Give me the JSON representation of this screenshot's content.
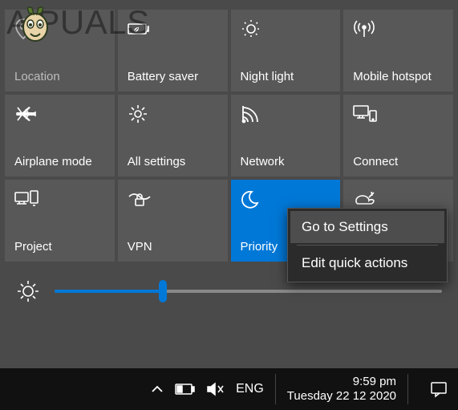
{
  "watermark": "A   PUALS",
  "tiles": [
    {
      "label": "Location",
      "icon": "location-icon",
      "state": "dimmed"
    },
    {
      "label": "Battery saver",
      "icon": "battery-leaf-icon",
      "state": "normal"
    },
    {
      "label": "Night light",
      "icon": "night-light-icon",
      "state": "normal"
    },
    {
      "label": "Mobile hotspot",
      "icon": "hotspot-icon",
      "state": "normal"
    },
    {
      "label": "Airplane mode",
      "icon": "airplane-icon",
      "state": "normal"
    },
    {
      "label": "All settings",
      "icon": "gear-icon",
      "state": "normal"
    },
    {
      "label": "Network",
      "icon": "network-icon",
      "state": "normal"
    },
    {
      "label": "Connect",
      "icon": "connect-icon",
      "state": "normal"
    },
    {
      "label": "Project",
      "icon": "project-icon",
      "state": "normal"
    },
    {
      "label": "VPN",
      "icon": "vpn-icon",
      "state": "normal"
    },
    {
      "label": "Priority",
      "icon": "moon-icon",
      "state": "active"
    },
    {
      "label": "",
      "icon": "screen-snip-icon",
      "state": "normal"
    }
  ],
  "brightness": {
    "value_pct": 28
  },
  "context_menu": {
    "items": [
      "Go to Settings",
      "Edit quick actions"
    ],
    "hover_index": 0
  },
  "taskbar": {
    "lang": "ENG",
    "time": "9:59 pm",
    "date": "Tuesday 22 12 2020"
  },
  "colors": {
    "accent": "#0078d7",
    "tile_bg": "rgba(100,100,100,0.55)",
    "panel_bg": "#4a4a4a",
    "taskbar_bg": "#111"
  }
}
